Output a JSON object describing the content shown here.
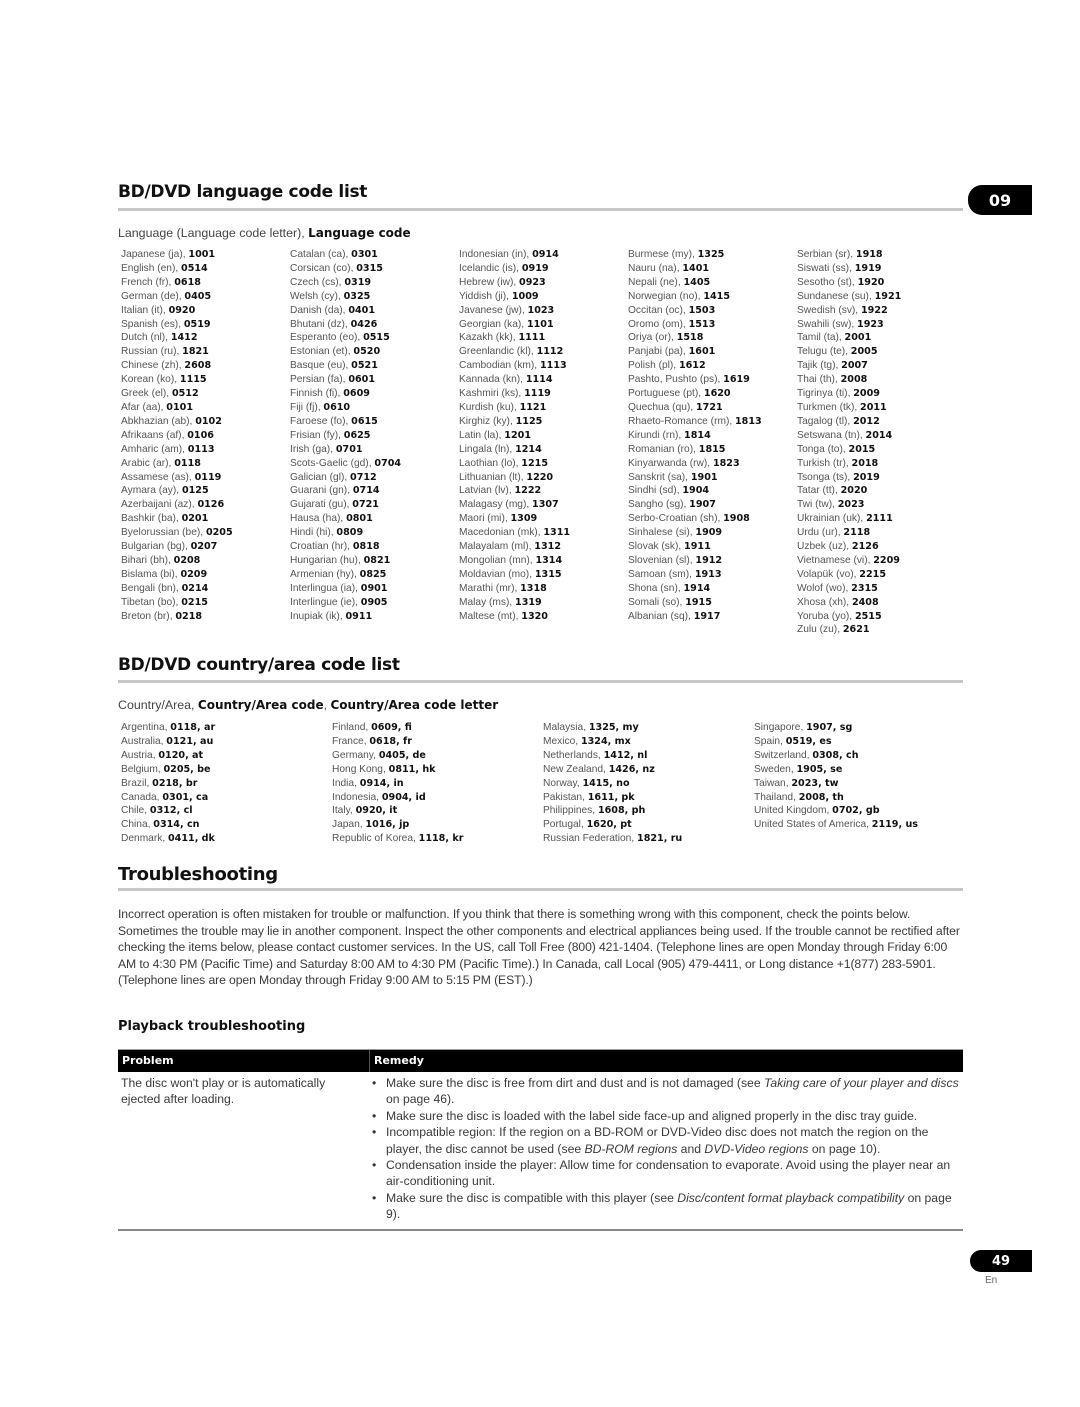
{
  "chapter_number": "09",
  "language_section": {
    "title": "BD/DVD language code list",
    "subhead_plain": "Language (Language code letter), ",
    "subhead_bold": "Language code",
    "columns": [
      [
        {
          "name": "Japanese (ja), ",
          "code": "1001"
        },
        {
          "name": "English (en), ",
          "code": "0514"
        },
        {
          "name": "French (fr), ",
          "code": "0618"
        },
        {
          "name": "German (de), ",
          "code": "0405"
        },
        {
          "name": "Italian (it), ",
          "code": "0920"
        },
        {
          "name": "Spanish (es), ",
          "code": "0519"
        },
        {
          "name": "Dutch (nl), ",
          "code": "1412"
        },
        {
          "name": "Russian (ru), ",
          "code": "1821"
        },
        {
          "name": "Chinese (zh), ",
          "code": "2608"
        },
        {
          "name": "Korean (ko), ",
          "code": "1115"
        },
        {
          "name": "Greek (el), ",
          "code": "0512"
        },
        {
          "name": "Afar (aa), ",
          "code": "0101"
        },
        {
          "name": "Abkhazian (ab), ",
          "code": "0102"
        },
        {
          "name": "Afrikaans (af), ",
          "code": "0106"
        },
        {
          "name": "Amharic (am), ",
          "code": "0113"
        },
        {
          "name": "Arabic (ar), ",
          "code": "0118"
        },
        {
          "name": "Assamese (as), ",
          "code": "0119"
        },
        {
          "name": "Aymara (ay), ",
          "code": "0125"
        },
        {
          "name": "Azerbaijani (az), ",
          "code": "0126"
        },
        {
          "name": "Bashkir (ba), ",
          "code": "0201"
        },
        {
          "name": "Byelorussian (be), ",
          "code": "0205"
        },
        {
          "name": "Bulgarian (bg), ",
          "code": "0207"
        },
        {
          "name": "Bihari (bh), ",
          "code": "0208"
        },
        {
          "name": "Bislama (bi), ",
          "code": "0209"
        },
        {
          "name": "Bengali (bn), ",
          "code": "0214"
        },
        {
          "name": "Tibetan (bo), ",
          "code": "0215"
        },
        {
          "name": "Breton (br), ",
          "code": "0218"
        }
      ],
      [
        {
          "name": "Catalan (ca), ",
          "code": "0301"
        },
        {
          "name": "Corsican (co), ",
          "code": "0315"
        },
        {
          "name": "Czech (cs), ",
          "code": "0319"
        },
        {
          "name": "Welsh (cy), ",
          "code": "0325"
        },
        {
          "name": "Danish (da), ",
          "code": "0401"
        },
        {
          "name": "Bhutani (dz), ",
          "code": "0426"
        },
        {
          "name": "Esperanto (eo), ",
          "code": "0515"
        },
        {
          "name": "Estonian (et), ",
          "code": "0520"
        },
        {
          "name": "Basque (eu), ",
          "code": "0521"
        },
        {
          "name": "Persian (fa), ",
          "code": "0601"
        },
        {
          "name": "Finnish (fi), ",
          "code": "0609"
        },
        {
          "name": "Fiji (fj), ",
          "code": "0610"
        },
        {
          "name": "Faroese (fo), ",
          "code": "0615"
        },
        {
          "name": "Frisian (fy), ",
          "code": "0625"
        },
        {
          "name": "Irish (ga), ",
          "code": "0701"
        },
        {
          "name": "Scots-Gaelic (gd), ",
          "code": "0704"
        },
        {
          "name": "Galician (gl), ",
          "code": "0712"
        },
        {
          "name": "Guarani (gn), ",
          "code": "0714"
        },
        {
          "name": "Gujarati (gu), ",
          "code": "0721"
        },
        {
          "name": "Hausa (ha), ",
          "code": "0801"
        },
        {
          "name": "Hindi (hi), ",
          "code": "0809"
        },
        {
          "name": "Croatian (hr), ",
          "code": "0818"
        },
        {
          "name": "Hungarian (hu), ",
          "code": "0821"
        },
        {
          "name": "Armenian (hy), ",
          "code": "0825"
        },
        {
          "name": "Interlingua (ia), ",
          "code": "0901"
        },
        {
          "name": "Interlingue (ie), ",
          "code": "0905"
        },
        {
          "name": "Inupiak (ik), ",
          "code": "0911"
        }
      ],
      [
        {
          "name": "Indonesian (in), ",
          "code": "0914"
        },
        {
          "name": "Icelandic (is), ",
          "code": "0919"
        },
        {
          "name": "Hebrew (iw), ",
          "code": "0923"
        },
        {
          "name": "Yiddish (ji), ",
          "code": "1009"
        },
        {
          "name": "Javanese (jw), ",
          "code": "1023"
        },
        {
          "name": "Georgian (ka), ",
          "code": "1101"
        },
        {
          "name": "Kazakh (kk), ",
          "code": "1111"
        },
        {
          "name": "Greenlandic (kl), ",
          "code": "1112"
        },
        {
          "name": "Cambodian (km), ",
          "code": "1113"
        },
        {
          "name": "Kannada (kn), ",
          "code": "1114"
        },
        {
          "name": "Kashmiri (ks), ",
          "code": "1119"
        },
        {
          "name": "Kurdish (ku), ",
          "code": "1121"
        },
        {
          "name": "Kirghiz (ky), ",
          "code": "1125"
        },
        {
          "name": "Latin (la), ",
          "code": "1201"
        },
        {
          "name": "Lingala (ln), ",
          "code": "1214"
        },
        {
          "name": "Laothian (lo), ",
          "code": "1215"
        },
        {
          "name": "Lithuanian (lt), ",
          "code": "1220"
        },
        {
          "name": "Latvian (lv), ",
          "code": "1222"
        },
        {
          "name": "Malagasy (mg), ",
          "code": "1307"
        },
        {
          "name": "Maori (mi), ",
          "code": "1309"
        },
        {
          "name": "Macedonian (mk), ",
          "code": "1311"
        },
        {
          "name": "Malayalam (ml), ",
          "code": "1312"
        },
        {
          "name": "Mongolian (mn), ",
          "code": "1314"
        },
        {
          "name": "Moldavian (mo), ",
          "code": "1315"
        },
        {
          "name": "Marathi (mr), ",
          "code": "1318"
        },
        {
          "name": "Malay (ms), ",
          "code": "1319"
        },
        {
          "name": "Maltese (mt), ",
          "code": "1320"
        }
      ],
      [
        {
          "name": "Burmese (my), ",
          "code": "1325"
        },
        {
          "name": "Nauru (na), ",
          "code": "1401"
        },
        {
          "name": "Nepali (ne), ",
          "code": "1405"
        },
        {
          "name": "Norwegian (no), ",
          "code": "1415"
        },
        {
          "name": "Occitan (oc), ",
          "code": "1503"
        },
        {
          "name": "Oromo (om), ",
          "code": "1513"
        },
        {
          "name": "Oriya (or), ",
          "code": "1518"
        },
        {
          "name": "Panjabi (pa), ",
          "code": "1601"
        },
        {
          "name": "Polish (pl), ",
          "code": "1612"
        },
        {
          "name": "Pashto, Pushto (ps), ",
          "code": "1619"
        },
        {
          "name": "Portuguese (pt), ",
          "code": "1620"
        },
        {
          "name": "Quechua (qu), ",
          "code": "1721"
        },
        {
          "name": "Rhaeto-Romance (rm), ",
          "code": "1813"
        },
        {
          "name": "Kirundi (rn), ",
          "code": "1814"
        },
        {
          "name": "Romanian (ro), ",
          "code": "1815"
        },
        {
          "name": "Kinyarwanda (rw), ",
          "code": "1823"
        },
        {
          "name": "Sanskrit (sa), ",
          "code": "1901"
        },
        {
          "name": "Sindhi (sd), ",
          "code": "1904"
        },
        {
          "name": "Sangho (sg), ",
          "code": "1907"
        },
        {
          "name": "Serbo-Croatian (sh), ",
          "code": "1908"
        },
        {
          "name": "Sinhalese (si), ",
          "code": "1909"
        },
        {
          "name": "Slovak (sk), ",
          "code": "1911"
        },
        {
          "name": "Slovenian (sl), ",
          "code": "1912"
        },
        {
          "name": "Samoan (sm), ",
          "code": "1913"
        },
        {
          "name": "Shona (sn), ",
          "code": "1914"
        },
        {
          "name": "Somali (so), ",
          "code": "1915"
        },
        {
          "name": "Albanian (sq), ",
          "code": "1917"
        }
      ],
      [
        {
          "name": "Serbian (sr), ",
          "code": "1918"
        },
        {
          "name": "Siswati (ss), ",
          "code": "1919"
        },
        {
          "name": "Sesotho (st), ",
          "code": "1920"
        },
        {
          "name": "Sundanese (su), ",
          "code": "1921"
        },
        {
          "name": "Swedish (sv), ",
          "code": "1922"
        },
        {
          "name": "Swahili (sw), ",
          "code": "1923"
        },
        {
          "name": "Tamil (ta), ",
          "code": "2001"
        },
        {
          "name": "Telugu (te), ",
          "code": "2005"
        },
        {
          "name": "Tajik (tg), ",
          "code": "2007"
        },
        {
          "name": "Thai (th), ",
          "code": "2008"
        },
        {
          "name": "Tigrinya (ti), ",
          "code": "2009"
        },
        {
          "name": "Turkmen (tk), ",
          "code": "2011"
        },
        {
          "name": "Tagalog (tl), ",
          "code": "2012"
        },
        {
          "name": "Setswana (tn), ",
          "code": "2014"
        },
        {
          "name": "Tonga (to), ",
          "code": "2015"
        },
        {
          "name": "Turkish (tr), ",
          "code": "2018"
        },
        {
          "name": "Tsonga (ts), ",
          "code": "2019"
        },
        {
          "name": "Tatar (tt), ",
          "code": "2020"
        },
        {
          "name": "Twi (tw), ",
          "code": "2023"
        },
        {
          "name": "Ukrainian (uk), ",
          "code": "2111"
        },
        {
          "name": "Urdu (ur), ",
          "code": "2118"
        },
        {
          "name": "Uzbek (uz), ",
          "code": "2126"
        },
        {
          "name": "Vietnamese (vi), ",
          "code": "2209"
        },
        {
          "name": "Volapük (vo), ",
          "code": "2215"
        },
        {
          "name": "Wolof (wo), ",
          "code": "2315"
        },
        {
          "name": "Xhosa (xh), ",
          "code": "2408"
        },
        {
          "name": "Yoruba (yo), ",
          "code": "2515"
        },
        {
          "name": "Zulu (zu), ",
          "code": "2621"
        }
      ]
    ]
  },
  "country_section": {
    "title": "BD/DVD country/area code list",
    "subhead_plain": "Country/Area, ",
    "subhead_bold_1": "Country/Area code",
    "subhead_sep": ", ",
    "subhead_bold_2": "Country/Area code letter",
    "columns": [
      [
        {
          "name": "Argentina, ",
          "code": "0118, ar"
        },
        {
          "name": "Australia, ",
          "code": "0121, au"
        },
        {
          "name": "Austria, ",
          "code": "0120, at"
        },
        {
          "name": "Belgium, ",
          "code": "0205, be"
        },
        {
          "name": "Brazil, ",
          "code": "0218, br"
        },
        {
          "name": "Canada, ",
          "code": "0301, ca"
        },
        {
          "name": "Chile, ",
          "code": "0312, cl"
        },
        {
          "name": "China, ",
          "code": "0314, cn"
        },
        {
          "name": "Denmark, ",
          "code": "0411, dk"
        }
      ],
      [
        {
          "name": "Finland, ",
          "code": "0609, fi"
        },
        {
          "name": "France, ",
          "code": "0618, fr"
        },
        {
          "name": "Germany, ",
          "code": "0405, de"
        },
        {
          "name": "Hong Kong, ",
          "code": "0811, hk"
        },
        {
          "name": "India, ",
          "code": "0914, in"
        },
        {
          "name": "Indonesia, ",
          "code": "0904, id"
        },
        {
          "name": "Italy, ",
          "code": "0920, it"
        },
        {
          "name": "Japan, ",
          "code": "1016, jp"
        },
        {
          "name": "Republic of Korea, ",
          "code": "1118, kr"
        }
      ],
      [
        {
          "name": "Malaysia, ",
          "code": "1325, my"
        },
        {
          "name": "Mexico, ",
          "code": "1324, mx"
        },
        {
          "name": "Netherlands, ",
          "code": "1412, nl"
        },
        {
          "name": "New Zealand, ",
          "code": "1426, nz"
        },
        {
          "name": "Norway, ",
          "code": "1415, no"
        },
        {
          "name": "Pakistan, ",
          "code": "1611, pk"
        },
        {
          "name": "Philippines, ",
          "code": "1608, ph"
        },
        {
          "name": "Portugal, ",
          "code": "1620, pt"
        },
        {
          "name": "Russian Federation, ",
          "code": "1821, ru"
        }
      ],
      [
        {
          "name": "Singapore, ",
          "code": "1907, sg"
        },
        {
          "name": "Spain, ",
          "code": "0519, es"
        },
        {
          "name": "Switzerland, ",
          "code": "0308, ch"
        },
        {
          "name": "Sweden, ",
          "code": "1905, se"
        },
        {
          "name": "Taiwan, ",
          "code": "2023, tw"
        },
        {
          "name": "Thailand, ",
          "code": "2008, th"
        },
        {
          "name": "United Kingdom, ",
          "code": "0702, gb"
        },
        {
          "name": "United States of America, ",
          "code": "2119, us"
        }
      ]
    ]
  },
  "troubleshooting": {
    "title": "Troubleshooting",
    "intro": "Incorrect operation is often mistaken for trouble or malfunction. If you think that there is something wrong with this component, check the points below. Sometimes the trouble may lie in another component. Inspect the other components and electrical appliances being used. If the trouble cannot be rectified after checking the items below, please contact customer services. In the US, call Toll Free (800) 421-1404. (Telephone lines are open Monday through Friday 6:00 AM to 4:30 PM (Pacific Time) and Saturday 8:00 AM to 4:30 PM (Pacific Time).) In Canada, call Local (905) 479-4411, or Long distance +1(877) 283-5901. (Telephone lines are open Monday through Friday 9:00 AM to 5:15 PM (EST).)",
    "playback_heading": "Playback troubleshooting",
    "table": {
      "col_problem": "Problem",
      "col_remedy": "Remedy",
      "rows": [
        {
          "problem": "The disc won't play or is automatically ejected after loading.",
          "remedies": [
            {
              "pre": "Make sure the disc is free from dirt and dust and is not damaged (see ",
              "ref1": "Taking care of your player and discs",
              "mid": " on page 46).",
              "ref2": "",
              "post": ""
            },
            {
              "pre": "Make sure the disc is loaded with the label side face-up and aligned properly in the disc tray guide.",
              "ref1": "",
              "mid": "",
              "ref2": "",
              "post": ""
            },
            {
              "pre": "Incompatible region: If the region on a BD-ROM or DVD-Video disc does not match the region on the player, the disc cannot be used (see ",
              "ref1": "BD-ROM regions",
              "mid": " and ",
              "ref2": "DVD-Video regions",
              "post": " on page 10)."
            },
            {
              "pre": "Condensation inside the player: Allow time for condensation to evaporate. Avoid using the player near an air-conditioning unit.",
              "ref1": "",
              "mid": "",
              "ref2": "",
              "post": ""
            },
            {
              "pre": "Make sure the disc is compatible with this player (see ",
              "ref1": "Disc/content format playback compatibility",
              "mid": " on page 9).",
              "ref2": "",
              "post": ""
            }
          ]
        }
      ]
    }
  },
  "footer": {
    "page_number": "49",
    "language": "En"
  }
}
